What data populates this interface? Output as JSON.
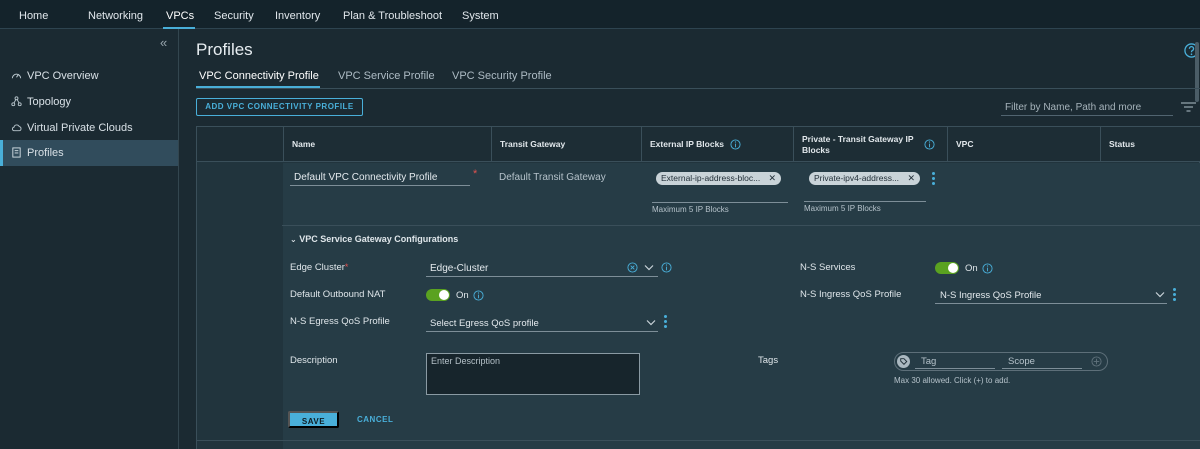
{
  "topnav": {
    "items": [
      {
        "label": "Home"
      },
      {
        "label": "Networking"
      },
      {
        "label": "VPCs"
      },
      {
        "label": "Security"
      },
      {
        "label": "Inventory"
      },
      {
        "label": "Plan & Troubleshoot"
      },
      {
        "label": "System"
      }
    ],
    "active": "VPCs"
  },
  "sidebar": {
    "collapse_glyph": "«",
    "items": [
      {
        "label": "VPC Overview",
        "icon": "gauge-icon"
      },
      {
        "label": "Topology",
        "icon": "topology-icon"
      },
      {
        "label": "Virtual Private Clouds",
        "icon": "cloud-icon"
      },
      {
        "label": "Profiles",
        "icon": "document-icon"
      }
    ],
    "active": "Profiles"
  },
  "page": {
    "title": "Profiles",
    "tabs": [
      {
        "label": "VPC Connectivity Profile"
      },
      {
        "label": "VPC Service Profile"
      },
      {
        "label": "VPC Security Profile"
      }
    ],
    "active_tab": "VPC Connectivity Profile",
    "add_button": "ADD VPC CONNECTIVITY PROFILE",
    "filter_placeholder": "Filter by Name, Path and more"
  },
  "grid": {
    "columns": {
      "name": "Name",
      "transit_gateway": "Transit Gateway",
      "external_ip_blocks": "External IP Blocks",
      "private_tgw_line1": "Private - Transit Gateway IP",
      "private_tgw_line2": "Blocks",
      "vpc": "VPC",
      "status": "Status"
    },
    "row": {
      "name": "Default VPC Connectivity Profile",
      "transit_gateway": "Default Transit Gateway",
      "external_chip": "External-ip-address-bloc...",
      "external_hint": "Maximum 5 IP Blocks",
      "private_chip": "Private-ipv4-address...",
      "private_hint": "Maximum 5 IP Blocks"
    }
  },
  "form": {
    "section_title": "VPC Service Gateway Configurations",
    "edge_cluster_label": "Edge Cluster",
    "edge_cluster_value": "Edge-Cluster",
    "default_outbound_nat_label": "Default Outbound NAT",
    "default_outbound_nat_state": "On",
    "egress_label": "N-S Egress QoS Profile",
    "egress_value": "Select Egress QoS profile",
    "ns_services_label": "N-S Services",
    "ns_services_state": "On",
    "ingress_label": "N-S Ingress QoS Profile",
    "ingress_value": "N-S Ingress QoS Profile",
    "description_label": "Description",
    "description_placeholder": "Enter Description",
    "tags_label": "Tags",
    "tag_placeholder": "Tag",
    "scope_placeholder": "Scope",
    "tags_hint": "Max 30 allowed. Click (+) to add.",
    "save": "SAVE",
    "cancel": "CANCEL"
  },
  "colors": {
    "accent": "#49afd9",
    "toggle_on": "#5aa220",
    "required": "#e0524f"
  }
}
